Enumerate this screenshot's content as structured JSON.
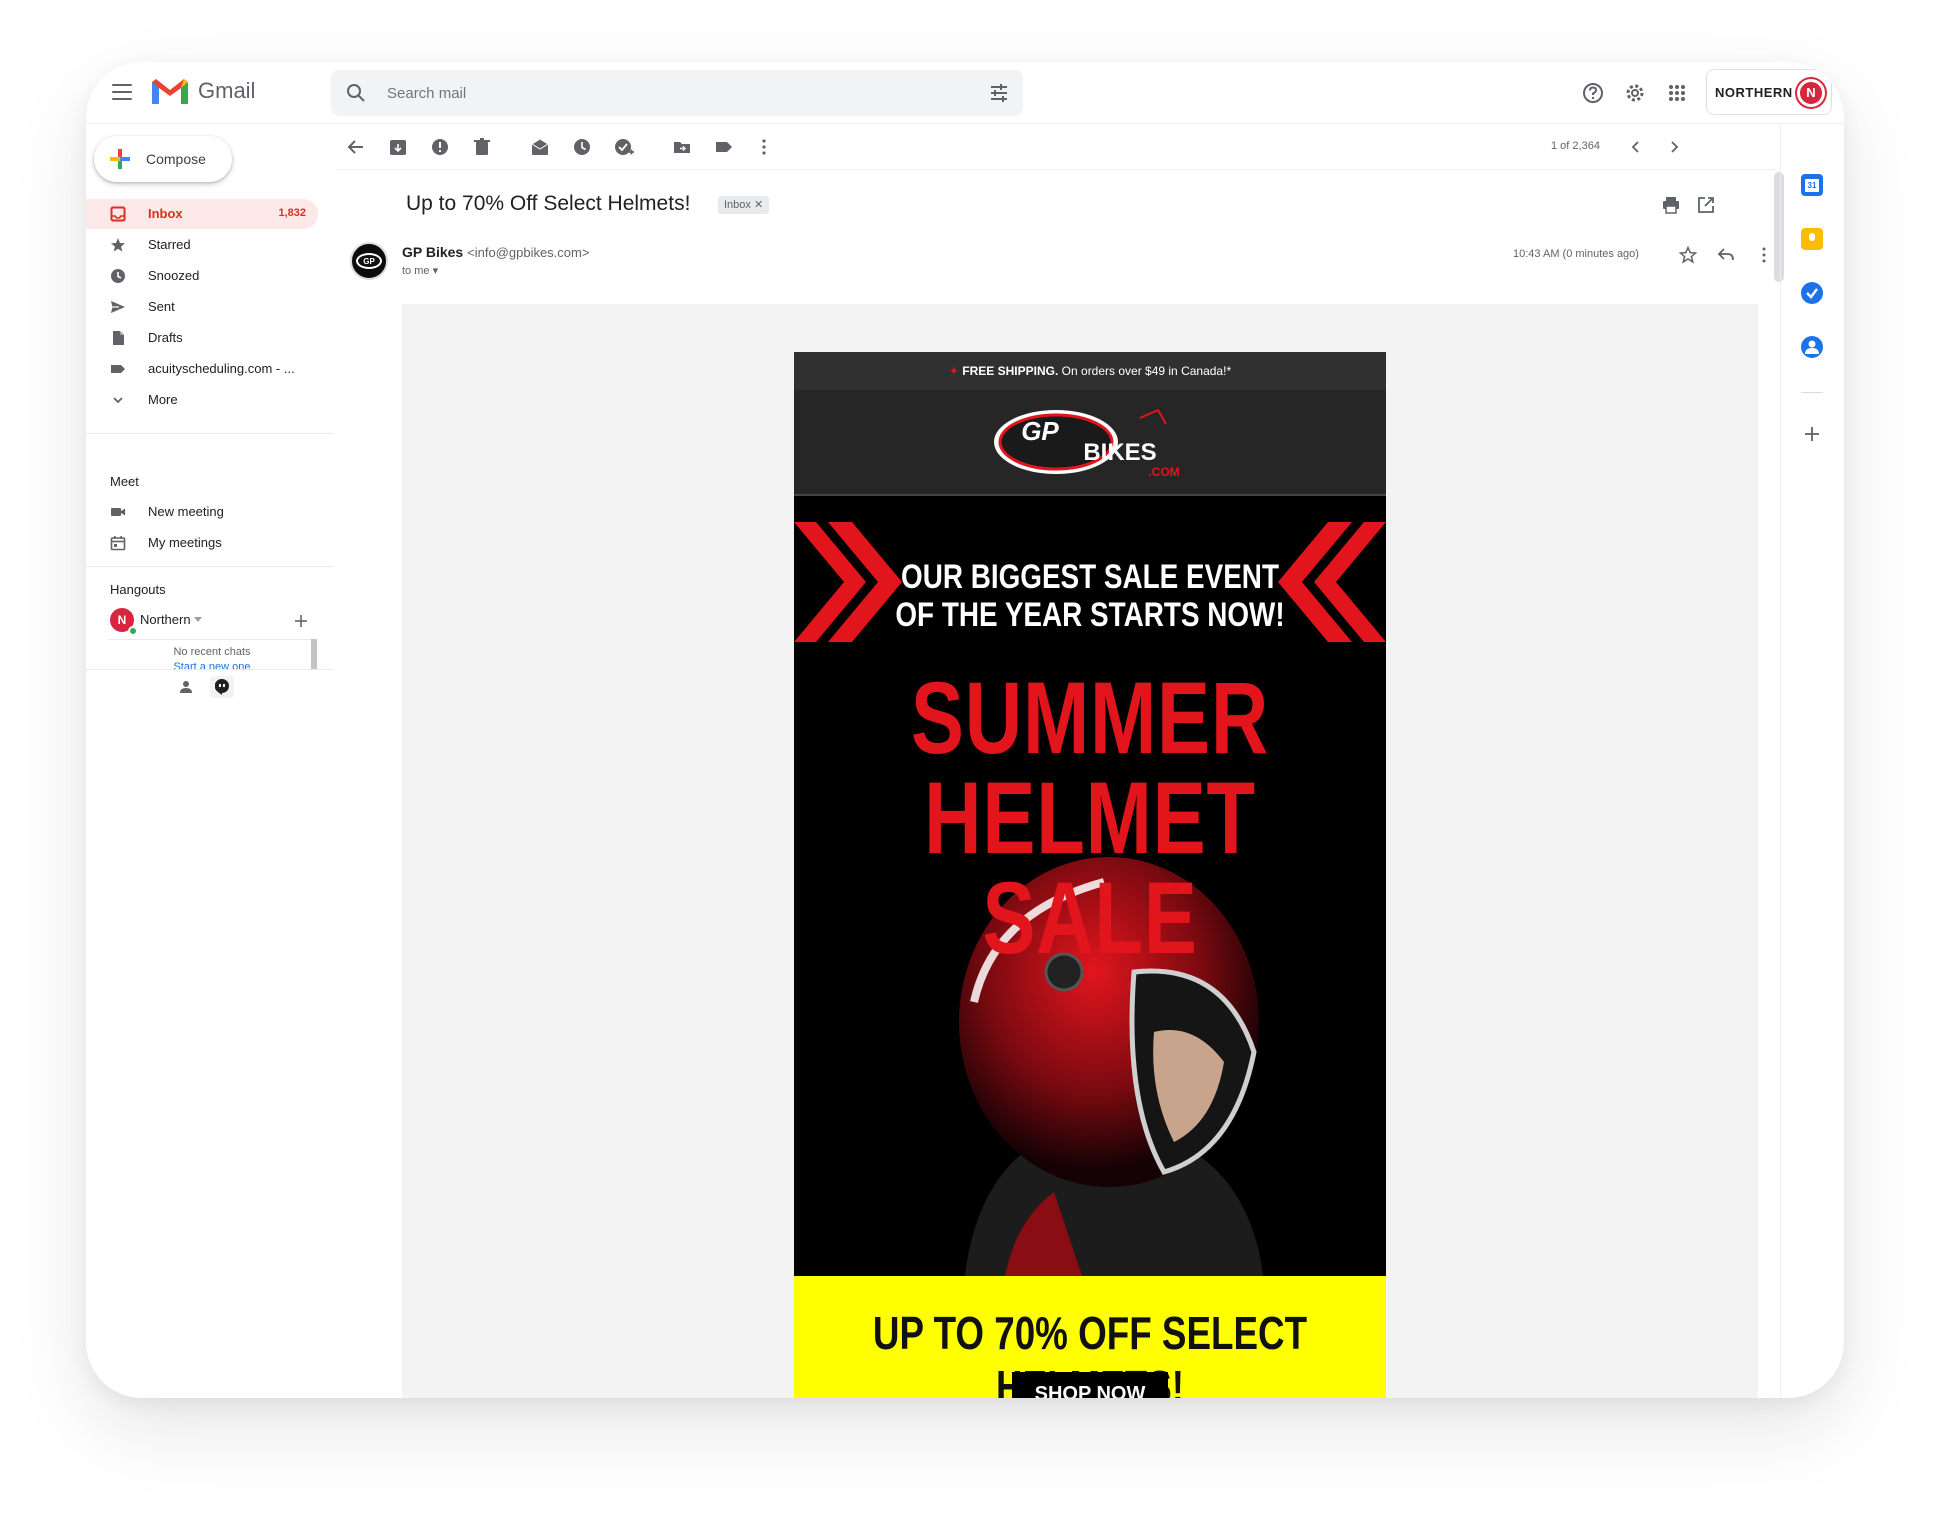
{
  "app": {
    "name": "Gmail"
  },
  "search": {
    "placeholder": "Search mail"
  },
  "account": {
    "name": "NORTHERN",
    "initial": "N"
  },
  "sidebar": {
    "compose": "Compose",
    "items": [
      {
        "label": "Inbox",
        "count": "1,832"
      },
      {
        "label": "Starred"
      },
      {
        "label": "Snoozed"
      },
      {
        "label": "Sent"
      },
      {
        "label": "Drafts"
      },
      {
        "label": "acuityscheduling.com - ..."
      },
      {
        "label": "More"
      }
    ],
    "meet": {
      "title": "Meet",
      "new_meeting": "New meeting",
      "my_meetings": "My meetings"
    },
    "hangouts": {
      "title": "Hangouts",
      "user": "Northern",
      "user_initial": "N",
      "no_chats": "No recent chats",
      "start_new": "Start a new one"
    }
  },
  "toolbar": {
    "pager": "1 of 2,364"
  },
  "email": {
    "subject": "Up to 70% Off Select Helmets!",
    "label_chip": "Inbox",
    "sender_name": "GP Bikes",
    "sender_email": "<info@gpbikes.com>",
    "to": "to me",
    "time": "10:43 AM (0 minutes ago)"
  },
  "newsletter": {
    "shipping_bold": "FREE SHIPPING.",
    "shipping_rest": "On orders over $49 in Canada!*",
    "logo_gp": "GP",
    "logo_bikes": "BIKES",
    "logo_com": ".COM",
    "headline_1": "OUR BIGGEST SALE EVENT",
    "headline_2": "OF THE YEAR STARTS NOW!",
    "hero_1": "SUMMER",
    "hero_2": "HELMET SALE",
    "promo": "UP TO 70% OFF SELECT HELMETS!",
    "cta": "SHOP NOW"
  },
  "colors": {
    "accent_red": "#e2151d",
    "promo_yellow": "#ffff00",
    "gmail_red": "#d93025"
  }
}
